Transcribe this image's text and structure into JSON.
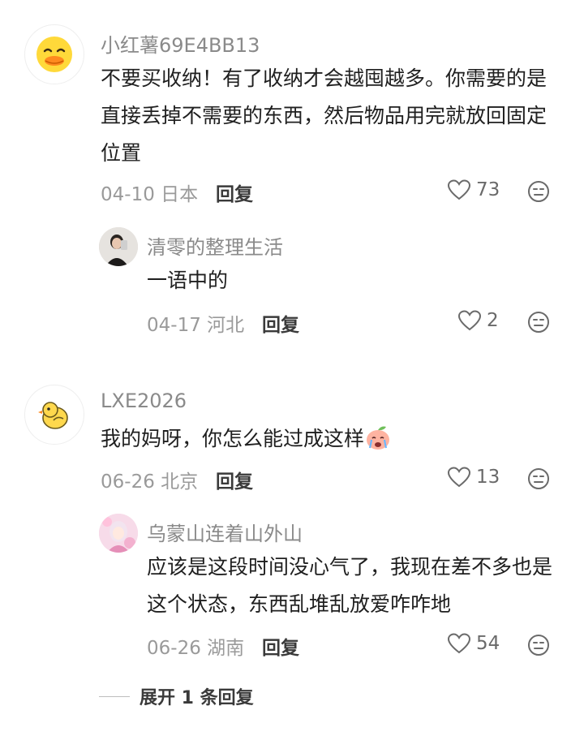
{
  "comments": [
    {
      "username": "小红薯69E4BB13",
      "text": "不要买收纳！有了收纳才会越囤越多。你需要的是直接丢掉不需要的东西，然后物品用完就放回固定位置",
      "date": "04-10",
      "location": "日本",
      "reply_label": "回复",
      "likes": "73",
      "avatar_icon": "yellow-duck-face-icon",
      "reply": {
        "username": "清零的整理生活",
        "text": "一语中的",
        "date": "04-17",
        "location": "河北",
        "reply_label": "回复",
        "likes": "2",
        "avatar_icon": "mirror-selfie-photo"
      }
    },
    {
      "username": "LXE2026",
      "text": "我的妈呀，你怎么能过成这样",
      "text_emoji": "crying-peach-sticker-icon",
      "date": "06-26",
      "location": "北京",
      "reply_label": "回复",
      "likes": "13",
      "avatar_icon": "yellow-chick-icon",
      "reply": {
        "username": "乌蒙山连着山外山",
        "text": "应该是这段时间没心气了，我现在差不多也是这个状态，东西乱堆乱放爱咋咋地",
        "date": "06-26",
        "location": "湖南",
        "reply_label": "回复",
        "likes": "54",
        "avatar_icon": "pink-anime-girl-photo"
      }
    }
  ],
  "expand_replies_label": "展开 1 条回复",
  "colors": {
    "username": "#8a8a8a",
    "meta": "#9a9a9a",
    "text": "#1f1f1f"
  }
}
